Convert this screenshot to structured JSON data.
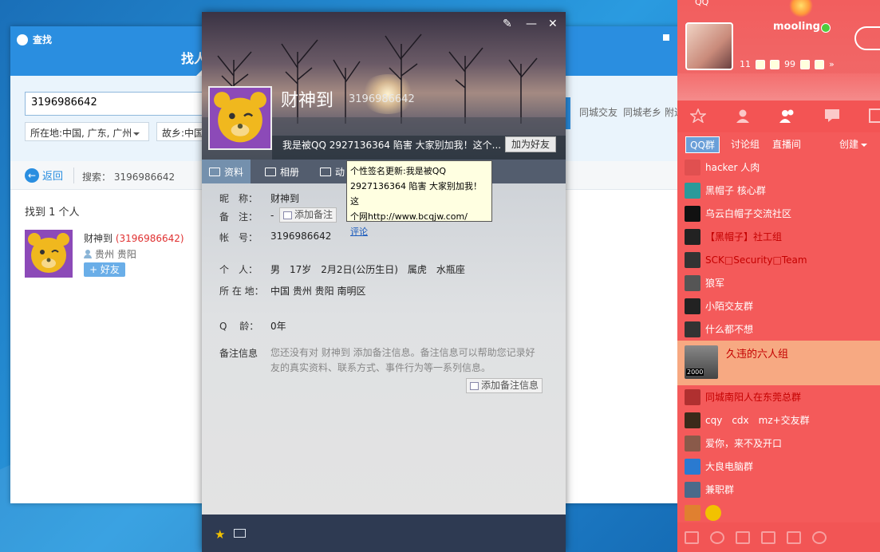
{
  "find_window": {
    "title": "查找",
    "active_tab": "找人",
    "search_value": "3196986642",
    "location_select": "所在地:中国, 广东, 广州",
    "hometown_select": "故乡:中国",
    "extra_filters": [
      "同城交友",
      "同城老乡",
      "附近"
    ],
    "back_label": "返回",
    "search_summary": "搜索： 3196986642",
    "found_text": "找到 1 个人",
    "result": {
      "name": "财神到",
      "number": "(3196986642)",
      "location": "贵州 贵阳",
      "add_label": "+ 好友"
    }
  },
  "profile_card": {
    "name": "财神到",
    "qq_number": "3196986642",
    "signature": "我是被QQ 2927136364 陷害 大家别加我！这个...",
    "add_friend_label": "加为好友",
    "tabs": [
      {
        "label": "资料",
        "icon": "profile-card-icon"
      },
      {
        "label": "相册",
        "icon": "photo-icon"
      },
      {
        "label": "动",
        "icon": "list-icon"
      }
    ],
    "fields": {
      "nickname_label": "昵　称：",
      "nickname_value": "财神到",
      "remark_label": "备　注：",
      "remark_value": "-",
      "add_remark": "添加备注",
      "account_label": "帐　号：",
      "account_value": "3196986642",
      "personal_label": "个　人：",
      "personal_value": "男　17岁　2月2日(公历生日)　属虎　水瓶座",
      "location_label": "所 在 地：",
      "location_value": "中国 贵州 贵阳 南明区",
      "qage_label": "Q　 龄：",
      "qage_value": "0年",
      "note_label": "备注信息",
      "note_text": "您还没有对 财神到 添加备注信息。备注信息可以帮助您记录好友的真实资料、联系方式、事件行为等一系列信息。",
      "add_note": "添加备注信息"
    }
  },
  "tooltip": {
    "line1": "个性签名更新:我是被QQ",
    "line2": "2927136364 陷害 大家别加我！这",
    "line3": "个网http://www.bcqjw.com/",
    "link": "评论"
  },
  "qq_panel": {
    "app_title": "QQ",
    "nickname": "mooling",
    "stats": {
      "mail_count": "99",
      "q_count": "11"
    },
    "subtabs": [
      "QQ群",
      "讨论组",
      "直播间"
    ],
    "create_label": "创建",
    "groups": [
      {
        "name": "hacker 人肉",
        "red": false,
        "color": "#e05050"
      },
      {
        "name": "黑帽子 核心群",
        "red": false,
        "color": "#2a9a9a"
      },
      {
        "name": "乌云白帽子交流社区",
        "red": false,
        "color": "#111111"
      },
      {
        "name": "【黑帽子】社工组",
        "red": true,
        "color": "#222222"
      },
      {
        "name": "SCK□Security□Team",
        "red": true,
        "color": "#333333"
      },
      {
        "name": "狼军",
        "red": false,
        "color": "#555555"
      },
      {
        "name": "小陌交友群",
        "red": false,
        "color": "#222222"
      },
      {
        "name": "什么都不想",
        "red": false,
        "color": "#333333"
      }
    ],
    "highlight_group": {
      "name": "久违的六人组",
      "badge": "2000"
    },
    "groups_after": [
      {
        "name": "同城南阳人在东莞总群",
        "red": true,
        "color": "#b03030"
      },
      {
        "name": "cqy　cdx　mz+交友群",
        "red": false,
        "color": "#3a2a1a"
      },
      {
        "name": "爱你，来不及开口",
        "red": false,
        "color": "#8a5a4a"
      },
      {
        "name": "大良电脑群",
        "red": false,
        "color": "#2a7ad0"
      },
      {
        "name": "兼职群",
        "red": false,
        "color": "#4a6a8a"
      },
      {
        "name": "",
        "red": false,
        "color": "#e08030"
      }
    ]
  }
}
